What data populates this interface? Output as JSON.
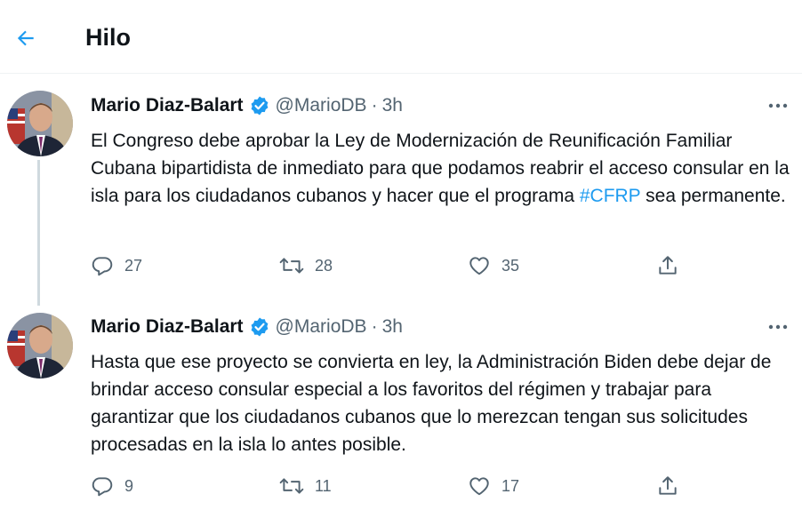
{
  "header": {
    "title": "Hilo",
    "back_icon": "arrow-left-icon"
  },
  "colors": {
    "accent": "#1d9bf0",
    "text": "#0f1419",
    "secondary": "#536471"
  },
  "tweets": [
    {
      "author": "Mario Diaz-Balart",
      "handle": "@MarioDB",
      "separator": "·",
      "time": "3h",
      "text_parts": [
        "El Congreso debe aprobar la Ley de Modernización de Reunificación Familiar Cubana bipartidista de inmediato para que podamos reabrir el acceso consular en la isla para los ciudadanos cubanos y hacer que el programa ",
        "#CFRP",
        " sea permanente."
      ],
      "replies": "27",
      "retweets": "28",
      "likes": "35"
    },
    {
      "author": "Mario Diaz-Balart",
      "handle": "@MarioDB",
      "separator": "·",
      "time": "3h",
      "text_parts": [
        "Hasta que ese proyecto se convierta en ley, la Administración Biden debe dejar de brindar acceso consular especial a los favoritos del régimen y trabajar para garantizar que los ciudadanos cubanos que lo merezcan tengan sus solicitudes procesadas en la isla lo antes posible."
      ],
      "replies": "9",
      "retweets": "11",
      "likes": "17"
    }
  ]
}
